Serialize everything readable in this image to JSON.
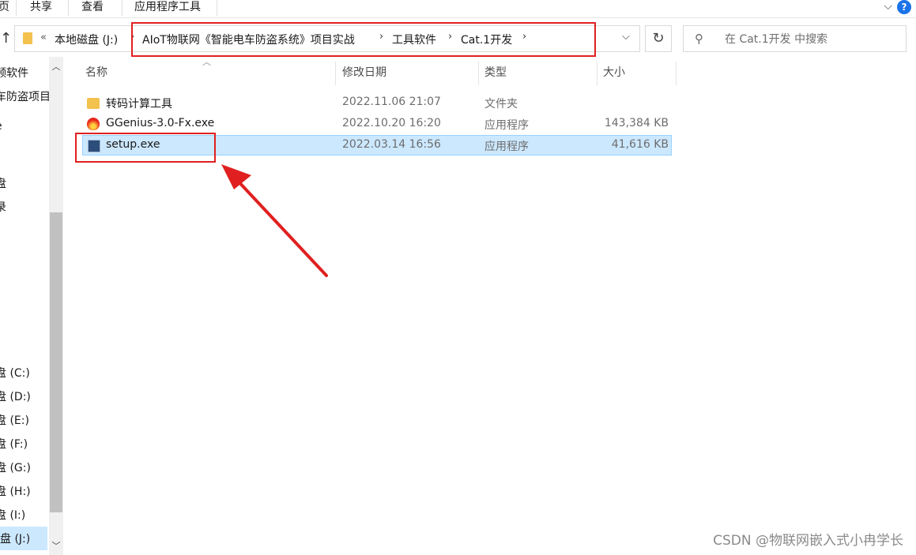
{
  "ribbon": {
    "tabs": [
      "页",
      "共享",
      "查看",
      "应用程序工具"
    ],
    "help": "?"
  },
  "address": {
    "overflow": "«",
    "crumbs": [
      "本地磁盘 (J:)",
      "AIoT物联网《智能电车防盗系统》项目实战",
      "工具软件",
      "Cat.1开发"
    ],
    "dropdown": "⌵",
    "refresh": "↻"
  },
  "search": {
    "placeholder": "在 Cat.1开发 中搜索"
  },
  "nav": {
    "items": [
      "频软件",
      "车防盗项目",
      "e",
      "盘",
      "录",
      "盘 (C:)",
      "盘 (D:)",
      "盘 (E:)",
      "盘 (F:)",
      "盘 (G:)",
      "盘 (H:)",
      "盘 (I:)",
      "盘 (J:)"
    ]
  },
  "columns": {
    "name": "名称",
    "date": "修改日期",
    "type": "类型",
    "size": "大小"
  },
  "files": [
    {
      "name": "转码计算工具",
      "date": "2022.11.06 21:07",
      "type": "文件夹",
      "size": "",
      "icon": "folder-icon"
    },
    {
      "name": "GGenius-3.0-Fx.exe",
      "date": "2022.10.20 16:20",
      "type": "应用程序",
      "size": "143,384 KB",
      "icon": "flame-app-icon"
    },
    {
      "name": "setup.exe",
      "date": "2022.03.14 16:56",
      "type": "应用程序",
      "size": "41,616 KB",
      "icon": "setup-app-icon"
    }
  ],
  "watermark": "CSDN @物联网嵌入式小冉学长",
  "colors": {
    "selection": "#cce8ff",
    "highlight_box": "#e02020",
    "folder": "#f2c14e"
  }
}
